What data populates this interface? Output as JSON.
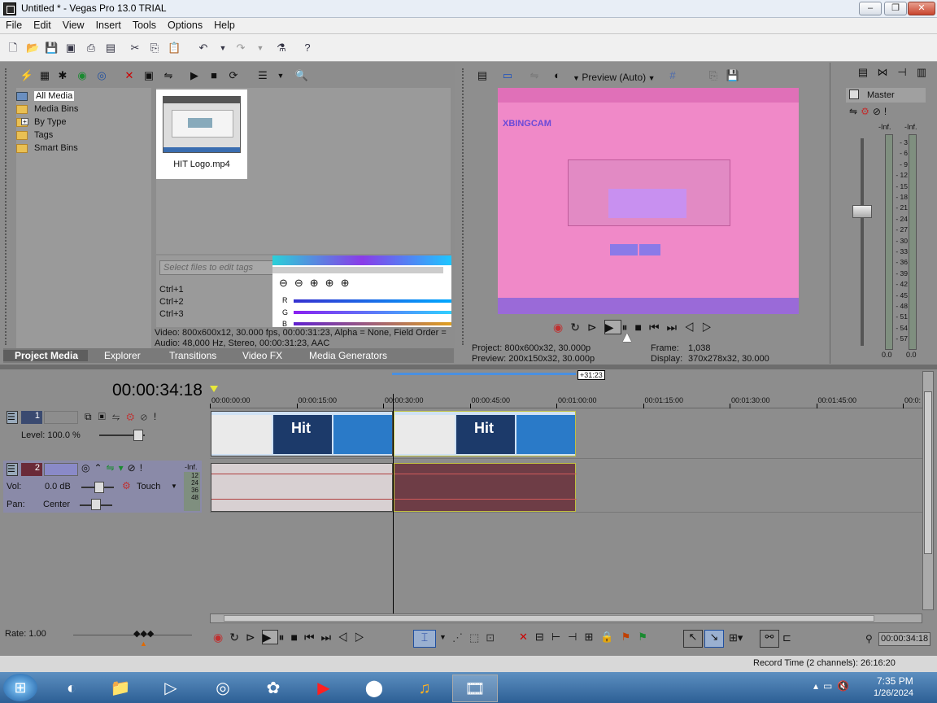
{
  "window": {
    "title": "Untitled * - Vegas Pro 13.0 TRIAL",
    "min": "–",
    "max": "❐",
    "close": "✕"
  },
  "menu": [
    "File",
    "Edit",
    "View",
    "Insert",
    "Tools",
    "Options",
    "Help"
  ],
  "explorer": {
    "tree": [
      "All Media",
      "Media Bins",
      "By Type",
      "Tags",
      "Smart Bins"
    ],
    "media_file": "HIT Logo.mp4",
    "tag_placeholder": "Select files to edit tags",
    "shortcuts": [
      "Ctrl+1",
      "Ctrl+2",
      "Ctrl+3"
    ],
    "rgb_labels": [
      "R",
      "G",
      "B"
    ],
    "info_video": "Video: 800x600x12, 30.000 fps, 00:00:31:23, Alpha = None, Field Order =",
    "info_audio": "Audio: 48,000 Hz, Stereo, 00:00:31:23, AAC"
  },
  "tabs": [
    "Project Media",
    "Explorer",
    "Transitions",
    "Video FX",
    "Media Generators"
  ],
  "preview": {
    "mode": "Preview (Auto)",
    "project_label": "Project:",
    "project_value": "800x600x32, 30.000p",
    "preview_label": "Preview:",
    "preview_value": "200x150x32, 30.000p",
    "frame_label": "Frame:",
    "frame_value": "1,038",
    "display_label": "Display:",
    "display_value": "370x278x32, 30.000",
    "screen_title": "XBINGCAM"
  },
  "master": {
    "title": "Master",
    "inf_l": "-Inf.",
    "inf_r": "-Inf.",
    "scale": [
      "3",
      "6",
      "9",
      "12",
      "15",
      "18",
      "21",
      "24",
      "27",
      "30",
      "33",
      "36",
      "39",
      "42",
      "45",
      "48",
      "51",
      "54",
      "57"
    ],
    "bottom_l": "0.0",
    "bottom_r": "0.0"
  },
  "timeline": {
    "timecode": "00:00:34:18",
    "marker": "+31:23",
    "ruler": [
      "00:00:00:00",
      "00:00:15:00",
      "00:00:30:00",
      "00:00:45:00",
      "00:01:00:00",
      "00:01:15:00",
      "00:01:30:00",
      "00:01:45:00",
      "00:0:"
    ],
    "video_track": {
      "num": "1",
      "level": "Level: 100.0 %"
    },
    "audio_track": {
      "num": "2",
      "vol_label": "Vol:",
      "vol_value": "0.0 dB",
      "pan_label": "Pan:",
      "pan_value": "Center",
      "mode": "Touch",
      "meter_inf": "-Inf.",
      "meter_scale": [
        "12",
        "24",
        "36",
        "48"
      ]
    },
    "rate": "Rate: 1.00",
    "end_time": "00:00:34:18"
  },
  "status": {
    "record_time": "Record Time (2 channels): 26:16:20"
  },
  "taskbar": {
    "time": "7:35 PM",
    "date": "1/26/2024"
  },
  "colors": {
    "preview_bg": "#f089c8",
    "audio_selected": "#6e3d46",
    "track_header": "#8a8aa8"
  }
}
